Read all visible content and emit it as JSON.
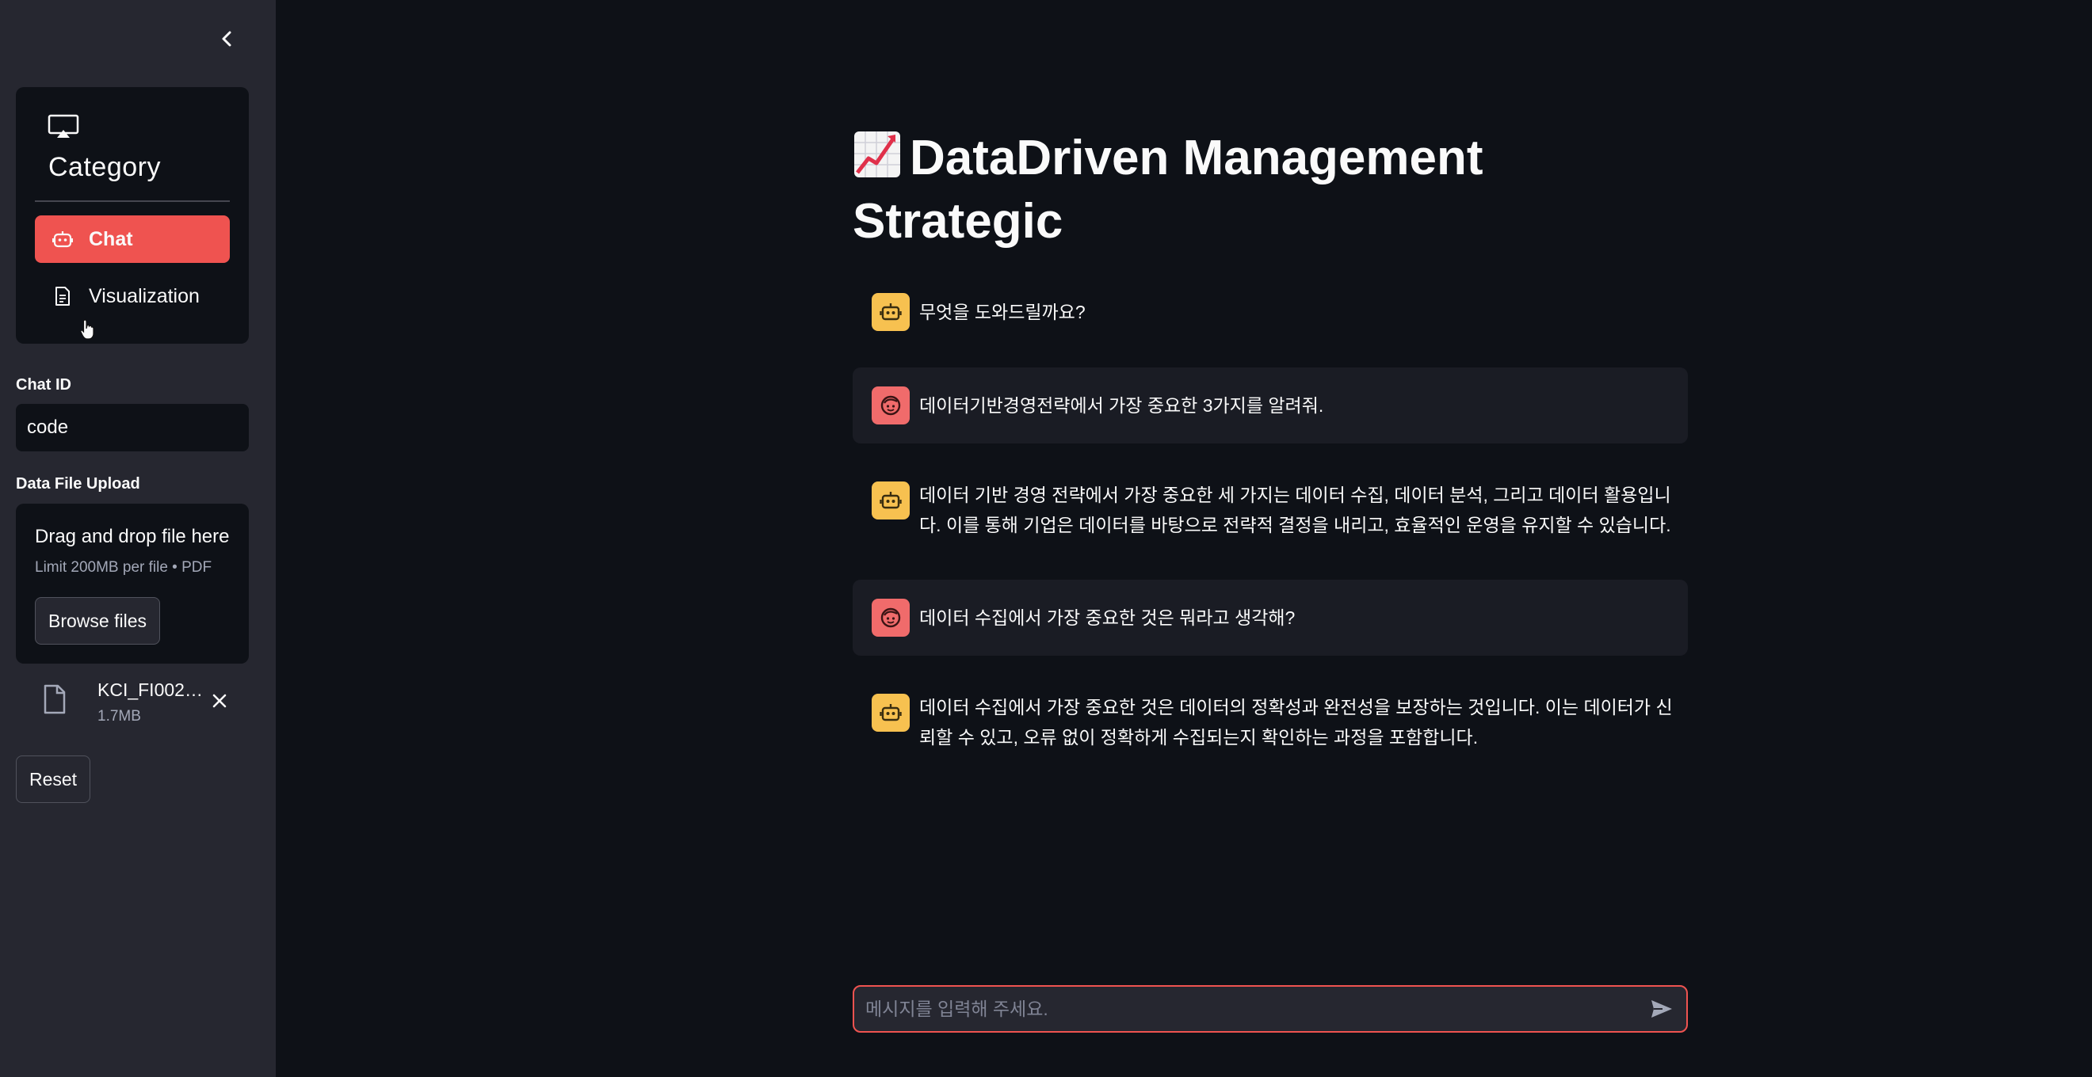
{
  "sidebar": {
    "collapse_icon": "chevron-left-icon",
    "nav": {
      "header_icon": "cast-icon",
      "title": "Category",
      "items": [
        {
          "label": "Chat",
          "icon": "robot-icon",
          "active": true
        },
        {
          "label": "Visualization",
          "icon": "document-icon",
          "active": false
        }
      ]
    },
    "chat_id": {
      "label": "Chat ID",
      "value": "code"
    },
    "upload": {
      "label": "Data File Upload",
      "drop_text": "Drag and drop file here",
      "limit_text": "Limit 200MB per file • PDF",
      "browse_label": "Browse files",
      "file": {
        "name": "KCI_FI0021...",
        "size": "1.7MB"
      }
    },
    "reset_label": "Reset"
  },
  "main": {
    "title": "DataDriven Management Strategic",
    "title_emoji": "chart-increasing-icon",
    "messages": [
      {
        "role": "assistant",
        "text": "무엇을 도와드릴까요?"
      },
      {
        "role": "user",
        "text": "데이터기반경영전략에서 가장 중요한 3가지를 알려줘."
      },
      {
        "role": "assistant",
        "text": "데이터 기반 경영 전략에서 가장 중요한 세 가지는 데이터 수집, 데이터 분석, 그리고 데이터 활용입니다. 이를 통해 기업은 데이터를 바탕으로 전략적 결정을 내리고, 효율적인 운영을 유지할 수 있습니다."
      },
      {
        "role": "user",
        "text": "데이터 수집에서 가장 중요한 것은 뭐라고 생각해?"
      },
      {
        "role": "assistant",
        "text": "데이터 수집에서 가장 중요한 것은 데이터의 정확성과 완전성을 보장하는 것입니다. 이는 데이터가 신뢰할 수 있고, 오류 없이 정확하게 수집되는지 확인하는 과정을 포함합니다."
      }
    ],
    "chat_input": {
      "placeholder": "메시지를 입력해 주세요.",
      "value": ""
    }
  },
  "colors": {
    "accent": "#ef5350",
    "sidebar_bg": "#262730",
    "main_bg": "#0e1117",
    "bot_avatar": "#f7c150",
    "user_avatar": "#f06b6b"
  }
}
